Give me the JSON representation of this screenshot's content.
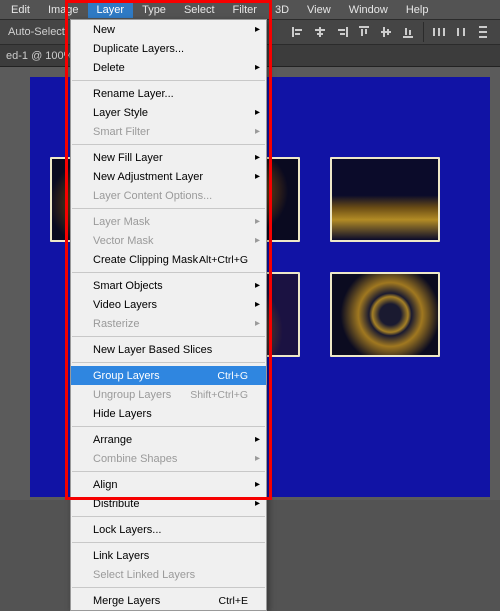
{
  "menubar": {
    "items": [
      "Edit",
      "Image",
      "Layer",
      "Type",
      "Select",
      "Filter",
      "3D",
      "View",
      "Window",
      "Help"
    ],
    "active_index": 2
  },
  "optbar": {
    "auto_select": "Auto-Select:"
  },
  "tabbar": {
    "label": "ed-1 @ 100% (…"
  },
  "menu": {
    "sections": [
      [
        {
          "label": "New",
          "submenu": true
        },
        {
          "label": "Duplicate Layers..."
        },
        {
          "label": "Delete",
          "submenu": true
        }
      ],
      [
        {
          "label": "Rename Layer..."
        },
        {
          "label": "Layer Style",
          "submenu": true
        },
        {
          "label": "Smart Filter",
          "submenu": true,
          "disabled": true
        }
      ],
      [
        {
          "label": "New Fill Layer",
          "submenu": true
        },
        {
          "label": "New Adjustment Layer",
          "submenu": true
        },
        {
          "label": "Layer Content Options...",
          "disabled": true
        }
      ],
      [
        {
          "label": "Layer Mask",
          "submenu": true,
          "disabled": true
        },
        {
          "label": "Vector Mask",
          "submenu": true,
          "disabled": true
        },
        {
          "label": "Create Clipping Mask",
          "shortcut": "Alt+Ctrl+G"
        }
      ],
      [
        {
          "label": "Smart Objects",
          "submenu": true
        },
        {
          "label": "Video Layers",
          "submenu": true
        },
        {
          "label": "Rasterize",
          "submenu": true,
          "disabled": true
        }
      ],
      [
        {
          "label": "New Layer Based Slices"
        }
      ],
      [
        {
          "label": "Group Layers",
          "shortcut": "Ctrl+G",
          "highlight": true
        },
        {
          "label": "Ungroup Layers",
          "shortcut": "Shift+Ctrl+G",
          "disabled": true
        },
        {
          "label": "Hide Layers"
        }
      ],
      [
        {
          "label": "Arrange",
          "submenu": true
        },
        {
          "label": "Combine Shapes",
          "submenu": true,
          "disabled": true
        }
      ],
      [
        {
          "label": "Align",
          "submenu": true
        },
        {
          "label": "Distribute",
          "submenu": true
        }
      ],
      [
        {
          "label": "Lock Layers..."
        }
      ],
      [
        {
          "label": "Link Layers"
        },
        {
          "label": "Select Linked Layers",
          "disabled": true
        }
      ],
      [
        {
          "label": "Merge Layers",
          "shortcut": "Ctrl+E"
        }
      ]
    ]
  }
}
